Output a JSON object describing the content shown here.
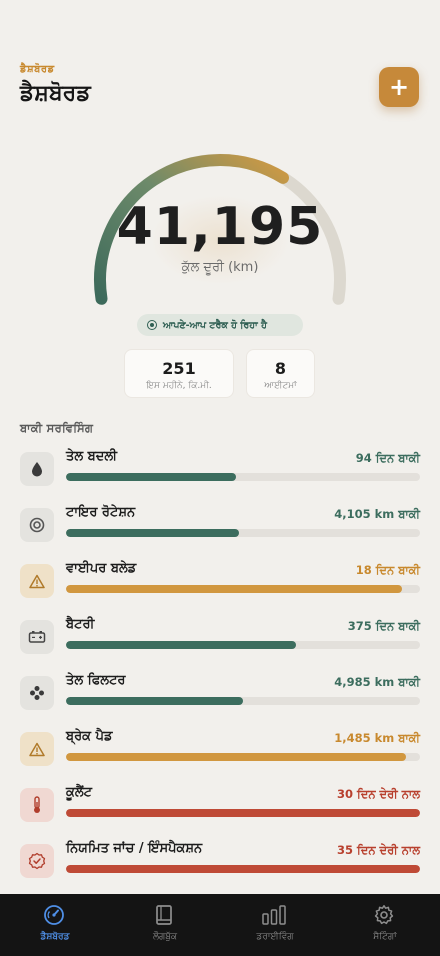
{
  "header": {
    "eyebrow": "ਡੈਸ਼ਬੋਰਡ",
    "title": "ਡੈਸ਼ਬੋਰਡ",
    "add_label": "+"
  },
  "odometer": {
    "value": "41,195",
    "label": "ਕੁੱਲ ਦੂਰੀ (km)",
    "progress": 0.66
  },
  "tracking": {
    "text": "ਆਪਣੇ-ਆਪ ਟਰੈਕ ਹੋ ਰਿਹਾ ਹੈ"
  },
  "stats": [
    {
      "value": "251",
      "label": "ਇਸ ਮਹੀਨੇ, ਕਿ.ਮੀ."
    },
    {
      "value": "8",
      "label": "ਆਈਟਮਾਂ"
    }
  ],
  "services": {
    "title": "ਬਾਕੀ ਸਰਵਿਸਿੰਗ",
    "items": [
      {
        "name": "ਤੇਲ ਬਦਲੀ",
        "status": "94 ਦਿਨ ਬਾਕੀ",
        "progress": 0.48,
        "color": "#3c6d5e",
        "status_color": "#3c6d5e",
        "icon": "drop-icon"
      },
      {
        "name": "ਟਾਇਰ ਰੋਟੇਸ਼ਨ",
        "status": "4,105 km ਬਾਕੀ",
        "progress": 0.49,
        "color": "#3c6d5e",
        "status_color": "#3c6d5e",
        "icon": "tire-icon"
      },
      {
        "name": "ਵਾਈਪਰ ਬਲੇਡ",
        "status": "18 ਦਿਨ ਬਾਕੀ",
        "progress": 0.95,
        "color": "#d1973f",
        "status_color": "#c8892e",
        "icon": "warning-icon"
      },
      {
        "name": "ਬੈਟਰੀ",
        "status": "375 ਦਿਨ ਬਾਕੀ",
        "progress": 0.65,
        "color": "#3c6d5e",
        "status_color": "#3c6d5e",
        "icon": "battery-icon"
      },
      {
        "name": "ਤੇਲ ਫਿਲਟਰ",
        "status": "4,985 km ਬਾਕੀ",
        "progress": 0.5,
        "color": "#3c6d5e",
        "status_color": "#3c6d5e",
        "icon": "filter-icon"
      },
      {
        "name": "ਬ੍ਰੇਕ ਪੈਡ",
        "status": "1,485 km ਬਾਕੀ",
        "progress": 0.96,
        "color": "#d1973f",
        "status_color": "#c8892e",
        "icon": "warning-icon"
      },
      {
        "name": "ਕੂਲੈਂਟ",
        "status": "30 ਦਿਨ ਦੇਰੀ ਨਾਲ",
        "progress": 1.0,
        "color": "#bf4a36",
        "status_color": "#b8402e",
        "icon": "thermometer-icon"
      },
      {
        "name": "ਨਿਯਮਿਤ ਜਾਂਚ / ਇੰਸਪੈਕਸ਼ਨ",
        "status": "35 ਦਿਨ ਦੇਰੀ ਨਾਲ",
        "progress": 1.0,
        "color": "#bf4a36",
        "status_color": "#b8402e",
        "icon": "badge-check-icon"
      }
    ]
  },
  "tabs": [
    {
      "label": "ਡੈਸ਼ਬੋਰਡ",
      "icon": "gauge-icon",
      "active": true
    },
    {
      "label": "ਲੌਗਬੁੱਕ",
      "icon": "book-icon",
      "active": false
    },
    {
      "label": "ਡਰਾਈਵਿੰਗ",
      "icon": "bars-icon",
      "active": false
    },
    {
      "label": "ਸੈਟਿੰਗਾਂ",
      "icon": "gear-icon",
      "active": false
    }
  ],
  "colors": {
    "accent": "#c6893a",
    "green": "#3c6d5e",
    "amber": "#d1973f",
    "red": "#bf4a36",
    "active_tab": "#4f8fe6"
  }
}
